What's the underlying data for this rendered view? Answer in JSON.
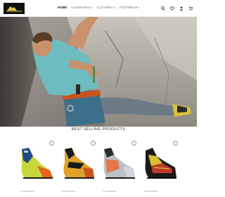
{
  "brand": {
    "logo_text": "LA SPORTIVA"
  },
  "nav": {
    "items": [
      {
        "label": "HOME",
        "active": true,
        "dropdown": false
      },
      {
        "label": "CLEARANCE",
        "active": false,
        "dropdown": true
      },
      {
        "label": "CLOTHING",
        "active": false,
        "dropdown": true
      },
      {
        "label": "FOOTWEAR",
        "active": false,
        "dropdown": true
      }
    ]
  },
  "header_icons": [
    "search-icon",
    "heart-icon",
    "user-icon",
    "cart-icon"
  ],
  "sections": {
    "best_selling_title": "BEST SELLING PRODUCTS"
  },
  "products": [
    {
      "name": "LA SPORTIVA",
      "colors": [
        "#1f4a8a",
        "#c7d638",
        "#e2661f"
      ]
    },
    {
      "name": "LA SPORTIVA",
      "colors": [
        "#1a1a1a",
        "#e0a12a",
        "#c9551f"
      ]
    },
    {
      "name": "LA SPORTIVA",
      "colors": [
        "#2b2b2b",
        "#e8764b",
        "#b9c0c8"
      ]
    },
    {
      "name": "LA SPORTIVA",
      "colors": [
        "#1a1a1a",
        "#d8c032",
        "#c2372b"
      ]
    }
  ],
  "colors": {
    "accent": "#111111",
    "text": "#333333"
  }
}
